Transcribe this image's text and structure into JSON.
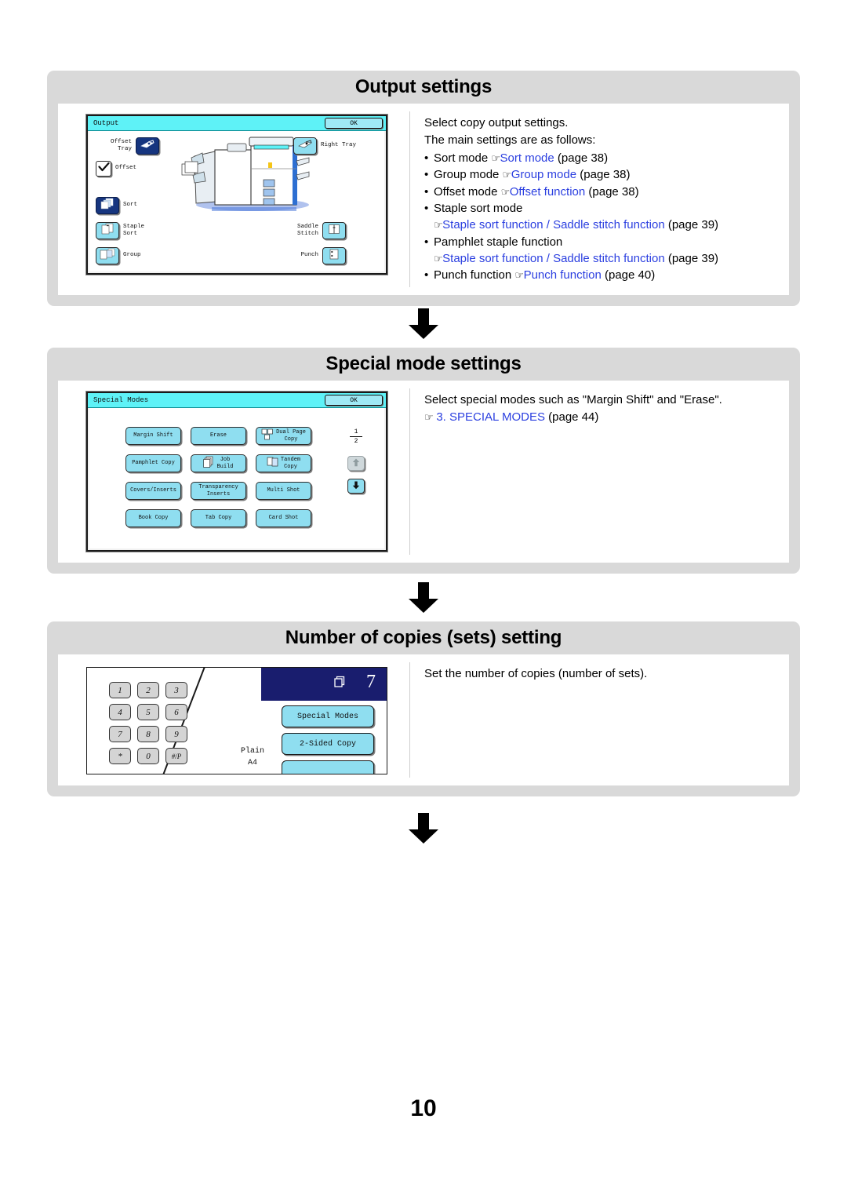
{
  "page": {
    "number": "10"
  },
  "sections": [
    {
      "id": "output-settings",
      "title": "Output settings",
      "screen": {
        "title": "Output",
        "ok_label": "OK",
        "left_controls": [
          {
            "label": "Offset\nTray",
            "icon": "offset-tray-icon",
            "selected": true
          },
          {
            "label": "Offset",
            "icon": "checkbox-checked-icon",
            "selected": false
          },
          {
            "label": "Sort",
            "icon": "sort-icon",
            "selected": true
          },
          {
            "label": "Staple\nSort",
            "icon": "staple-sort-icon",
            "selected": false
          },
          {
            "label": "Group",
            "icon": "group-icon",
            "selected": false
          }
        ],
        "right_controls": [
          {
            "label": "Right Tray",
            "icon": "right-tray-icon"
          },
          {
            "label": "Saddle\nStitch",
            "icon": "saddle-stitch-icon"
          },
          {
            "label": "Punch",
            "icon": "punch-icon"
          }
        ]
      },
      "description": {
        "intro": [
          "Select copy output settings.",
          "The main settings are as follows:"
        ],
        "items": [
          {
            "text": "Sort mode ",
            "link": "Sort mode",
            "page": " (page 38)"
          },
          {
            "text": "Group mode ",
            "link": "Group mode",
            "page": " (page 38)"
          },
          {
            "text": "Offset mode ",
            "link": "Offset function",
            "page": " (page 38)"
          },
          {
            "text": "Staple sort mode",
            "sub_link": "Staple sort function / Saddle stitch function",
            "sub_page": " (page 39)"
          },
          {
            "text": "Pamphlet staple function",
            "sub_link": "Staple sort function / Saddle stitch function",
            "sub_page": " (page 39)"
          },
          {
            "text": "Punch function ",
            "link": "Punch function",
            "page": " (page 40)"
          }
        ]
      }
    },
    {
      "id": "special-mode-settings",
      "title": "Special mode settings",
      "screen": {
        "title": "Special Modes",
        "ok_label": "OK",
        "buttons": [
          {
            "label": "Margin Shift",
            "icon": null
          },
          {
            "label": "Erase",
            "icon": null
          },
          {
            "label": "Dual Page\nCopy",
            "icon": "dual-page-copy-icon"
          },
          {
            "label": "Pamphlet Copy",
            "icon": null
          },
          {
            "label": "Job\nBuild",
            "icon": "job-build-icon"
          },
          {
            "label": "Tandem\nCopy",
            "icon": "tandem-copy-icon"
          },
          {
            "label": "Covers/Inserts",
            "icon": null
          },
          {
            "label": "Transparency\nInserts",
            "icon": null
          },
          {
            "label": "Multi Shot",
            "icon": null
          },
          {
            "label": "Book Copy",
            "icon": null
          },
          {
            "label": "Tab Copy",
            "icon": null
          },
          {
            "label": "Card Shot",
            "icon": null
          }
        ],
        "page_indicator": {
          "current": "1",
          "total": "2"
        },
        "nav": {
          "up": "up-arrow-icon",
          "down": "down-arrow-icon"
        }
      },
      "description": {
        "intro": [
          "Select special modes such as \"Margin Shift\" and \"Erase\"."
        ],
        "link": "3. SPECIAL MODES",
        "page": " (page 44)"
      }
    },
    {
      "id": "number-of-copies-setting",
      "title": "Number of copies (sets) setting",
      "screen": {
        "keys": [
          "1",
          "2",
          "3",
          "4",
          "5",
          "6",
          "7",
          "8",
          "9",
          "*",
          "0",
          "#/P"
        ],
        "count": "7",
        "buttons": [
          "Special Modes",
          "2-Sided Copy"
        ],
        "paper": [
          "Plain",
          "A4"
        ]
      },
      "description": {
        "intro": [
          "Set the number of copies (number of sets)."
        ]
      }
    }
  ],
  "colors": {
    "header_bg": "#d9d9d9",
    "link": "#2b3fe0",
    "lcd_titlebar": "#5ef2f7",
    "button_face": "#8fdef0",
    "button_selected": "#16357f",
    "np_display": "#191d6e"
  }
}
